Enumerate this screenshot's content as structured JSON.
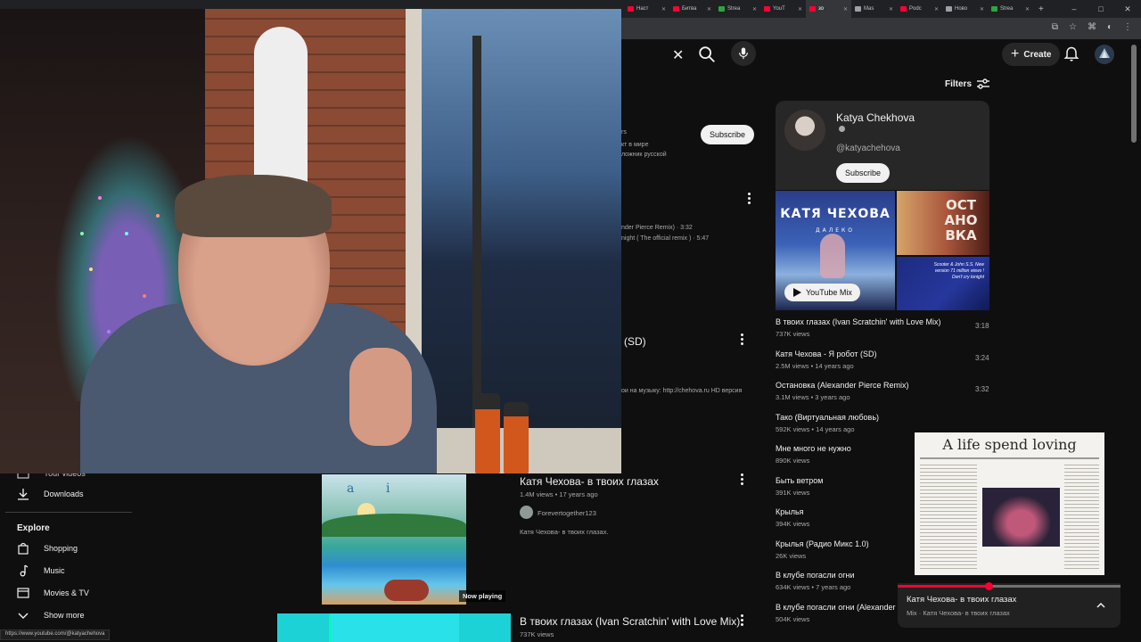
{
  "browser": {
    "tabs": [
      {
        "label": "Наст",
        "color": "#ff0033",
        "active": false
      },
      {
        "label": "Битва",
        "color": "#ff0033",
        "active": false
      },
      {
        "label": "Strea",
        "color": "#2ba640",
        "active": false
      },
      {
        "label": "YouT",
        "color": "#ff0033",
        "active": false
      },
      {
        "label": "зо",
        "color": "#ff0033",
        "active": true
      },
      {
        "label": "Mas",
        "color": "#9aa0a6",
        "active": false
      },
      {
        "label": "Podc",
        "color": "#ff0033",
        "active": false
      },
      {
        "label": "Ново",
        "color": "#9aa0a6",
        "active": false
      },
      {
        "label": "Strea",
        "color": "#2ba640",
        "active": false
      }
    ],
    "status_url": "https://www.youtube.com/@katyachehova"
  },
  "header": {
    "create_label": "Create"
  },
  "filters_label": "Filters",
  "main": {
    "channel_fragments": [
      "rs",
      "кт в мире",
      "ложник русской"
    ],
    "subscribe_label": "Subscribe",
    "track_fragments": [
      "nder Pierce Remix) · 3:32",
      "night ( The official remix ) · 5:47"
    ],
    "title_fragment": "(SD)",
    "desc_fragment": "ои на музыку: http://chehova.ru HD версия",
    "now_playing_label": "Now playing",
    "result1": {
      "title": "Катя Чехова- в твоих глазах",
      "meta": "1.4M views • 17 years ago",
      "channel": "Forevertogether123",
      "description": "Катя Чехова- в твоих глазах."
    },
    "result2": {
      "title": "В твоих глазах (Ivan Scratchin' with Love Mix)",
      "meta": "737K views"
    }
  },
  "channel_card": {
    "name": "Katya Chekhova",
    "handle": "@katyachehova",
    "subscribe_label": "Subscribe"
  },
  "mix": {
    "pill_label": "YouTube Mix",
    "big_thumb_text": "КАТЯ ЧЕХОВА",
    "big_thumb_subtext": "ДАЛЕКО",
    "tr_thumb_text": "ОСТ АНО ВКА",
    "br_thumb_text": "Scooter & John S.S. New version 71 million views ! Don't cry tonight"
  },
  "up_next": [
    {
      "title": "В твоих глазах (Ivan Scratchin' with Love Mix)",
      "meta": "737K views",
      "duration": "3:18"
    },
    {
      "title": "Катя Чехова - Я робот (SD)",
      "meta": "2.5M views • 14 years ago",
      "duration": "3:24"
    },
    {
      "title": "Остановка (Alexander Pierce Remix)",
      "meta": "3.1M views • 3 years ago",
      "duration": "3:32"
    },
    {
      "title": "Тако (Виртуальная любовь)",
      "meta": "592K views • 14 years ago",
      "duration": ""
    },
    {
      "title": "Мне много не нужно",
      "meta": "890K views",
      "duration": ""
    },
    {
      "title": "Быть ветром",
      "meta": "391K views",
      "duration": ""
    },
    {
      "title": "Крылья",
      "meta": "394K views",
      "duration": ""
    },
    {
      "title": "Крылья (Радио Микс 1.0)",
      "meta": "26K views",
      "duration": ""
    },
    {
      "title": "В клубе погасли огни",
      "meta": "634K views • 7 years ago",
      "duration": ""
    },
    {
      "title": "В клубе погасли огни (Alexander P",
      "meta": "504K views",
      "duration": ""
    }
  ],
  "sidebar": {
    "partial_label": "Your videos",
    "downloads_label": "Downloads",
    "explore_heading": "Explore",
    "explore_items": [
      "Shopping",
      "Music",
      "Movies & TV",
      "Show more"
    ]
  },
  "mini_player": {
    "page_heading": "A life spend loving",
    "title": "Катя Чехова- в твоих глазах",
    "subtitle": "Mix · Катя Чехова- в твоих глазах",
    "progress": 0.41
  },
  "colors": {
    "background": "#0f0f0f",
    "accent": "#ff0033",
    "card": "#272727"
  }
}
